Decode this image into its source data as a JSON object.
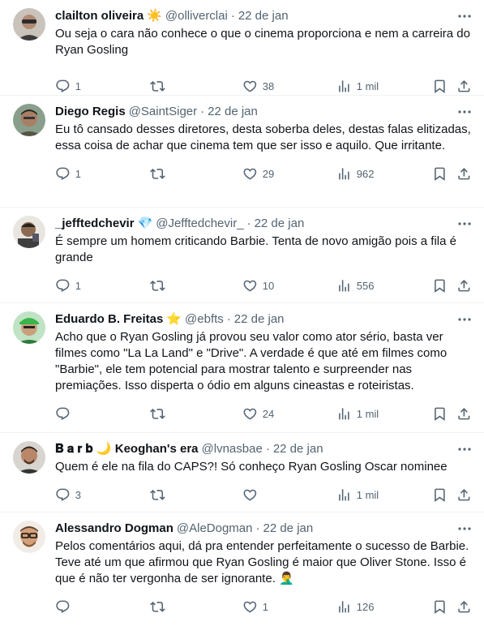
{
  "tweets": [
    {
      "name": "clailton oliveira",
      "badge": "☀️",
      "handle": "@olliverclai",
      "time": "22 de jan",
      "text": "Ou seja o cara não conhece o que o cinema proporciona e nem a carreira do Ryan Gosling",
      "replies": "1",
      "retweets": "",
      "likes": "38",
      "views": "1 mil"
    },
    {
      "name": "Diego Regis",
      "badge": "",
      "handle": "@SaintSiger",
      "time": "22 de jan",
      "text": "Eu tô cansado desses diretores, desta soberba deles, destas falas elitizadas, essa coisa de achar que cinema tem que ser isso e aquilo. Que irritante.",
      "replies": "1",
      "retweets": "",
      "likes": "29",
      "views": "962"
    },
    {
      "name": "_jefftedchevir",
      "badge": "💎",
      "handle": "@Jefftedchevir_",
      "time": "22 de jan",
      "text": "É sempre um homem criticando Barbie. Tenta de novo amigão pois a fila é grande",
      "replies": "1",
      "retweets": "",
      "likes": "10",
      "views": "556"
    },
    {
      "name": "Eduardo B. Freitas",
      "badge": "⭐",
      "handle": "@ebfts",
      "time": "22 de jan",
      "text": "Acho que o Ryan Gosling já provou seu valor como ator sério, basta ver filmes como \"La La Land\" e \"Drive\". A verdade é que até em filmes como \"Barbie\", ele tem potencial para mostrar talento e surpreender nas premiações. Isso disperta o ódio em alguns cineastas e roteiristas.",
      "replies": "",
      "retweets": "",
      "likes": "24",
      "views": "1 mil"
    },
    {
      "name": "𝐁 𝐚 𝐫 𝐛 🌙 Keoghan's era",
      "badge": "",
      "handle": "@lvnasbae",
      "time": "22 de jan",
      "text": "Quem é ele na fila do CAPS?! Só conheço Ryan Gosling Oscar nominee",
      "replies": "3",
      "retweets": "",
      "likes": "",
      "views": "1 mil"
    },
    {
      "name": "Alessandro Dogman",
      "badge": "",
      "handle": "@AleDogman",
      "time": "22 de jan",
      "text": "Pelos comentários aqui, dá pra entender perfeitamente o sucesso de Barbie. Teve até um que afirmou que Ryan Gosling é maior que Oliver Stone. Isso é que é não ter vergonha de ser ignorante. 🤦‍♂️",
      "replies": "",
      "retweets": "",
      "likes": "1",
      "views": "126"
    }
  ],
  "icons": {
    "reply": "reply-icon",
    "retweet": "retweet-icon",
    "like": "like-icon",
    "views": "views-icon",
    "bookmark": "bookmark-icon",
    "share": "share-icon",
    "more": "more-icon"
  },
  "colors": {
    "text": "#0f1419",
    "secondary": "#536471",
    "divider": "#eff3f4"
  }
}
